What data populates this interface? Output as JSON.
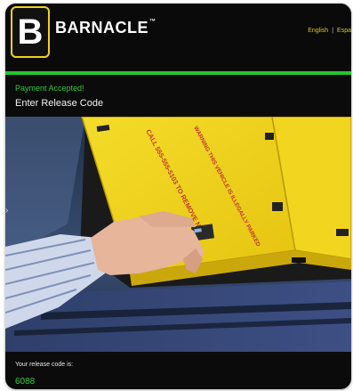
{
  "header": {
    "logo_letter": "B",
    "brand": "BARNACLE",
    "brand_mark": "™",
    "languages": [
      "English",
      "|",
      "Espa"
    ]
  },
  "status": {
    "message": "Payment Accepted!"
  },
  "main": {
    "heading": "Enter Release Code"
  },
  "device": {
    "warning_text": "CALL 555-555-5103 TO REMOVE NOW",
    "warning_text_2": "WARNING THIS VEHICLE IS ILLEGALLY PARKED"
  },
  "release": {
    "label": "Your release code is:",
    "code": "6088"
  },
  "colors": {
    "accent_green": "#22c82b",
    "text_green": "#37c73b",
    "device_yellow": "#f1d21a",
    "background": "#0b0b0b"
  }
}
